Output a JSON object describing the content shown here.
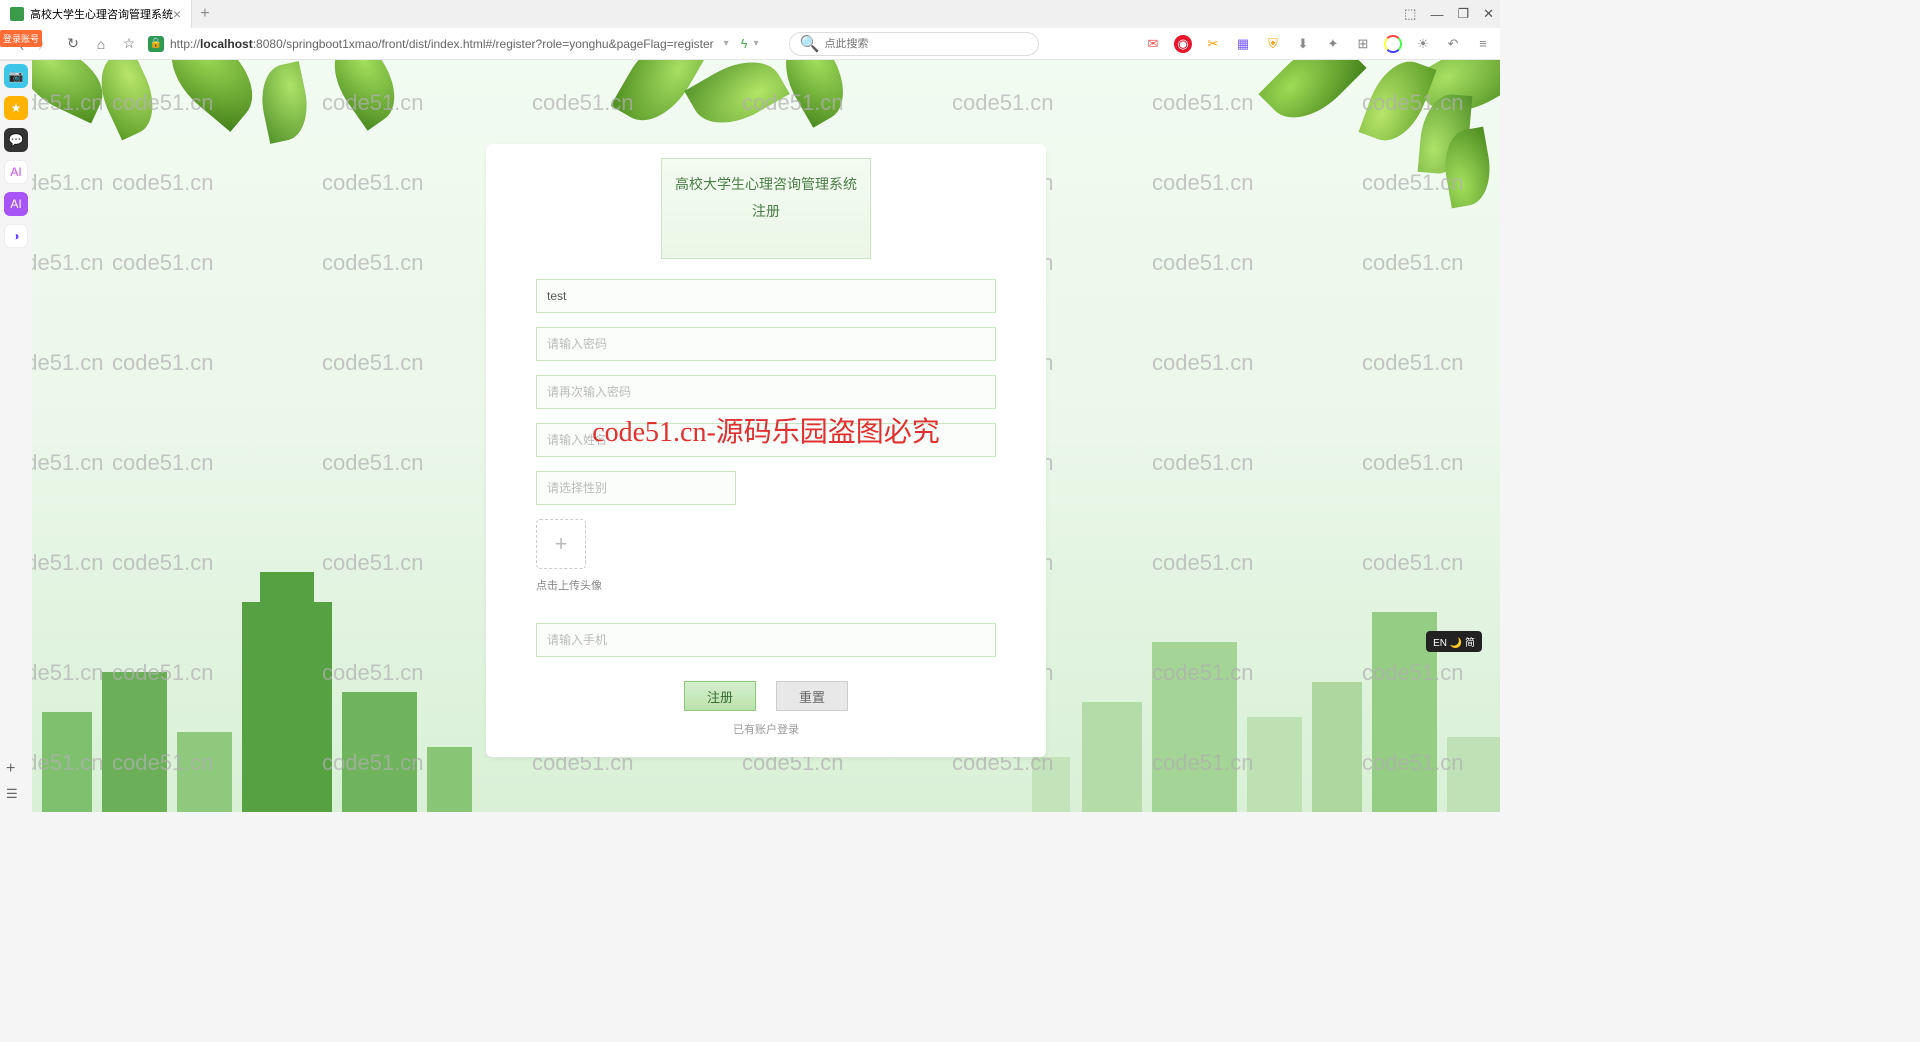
{
  "browser": {
    "tab_title": "高校大学生心理咨询管理系统",
    "url_prefix": "http://",
    "url_host": "localhost",
    "url_path": ":8080/springboot1xmao/front/dist/index.html#/register?role=yonghu&pageFlag=register",
    "search_placeholder": "点此搜索",
    "login_badge": "登录账号"
  },
  "form": {
    "title": "高校大学生心理咨询管理系统 注册",
    "username_value": "test",
    "password_placeholder": "请输入密码",
    "password_confirm_placeholder": "请再次输入密码",
    "nickname_placeholder": "请输入姓名",
    "gender_placeholder": "请选择性别",
    "upload_hint": "点击上传头像",
    "phone_placeholder": "请输入手机",
    "register_btn": "注册",
    "reset_btn": "重置",
    "login_link": "已有账户登录"
  },
  "watermark": {
    "text": "code51.cn",
    "center": "code51.cn-源码乐园盗图必究"
  },
  "ime": "EN 🌙 简"
}
